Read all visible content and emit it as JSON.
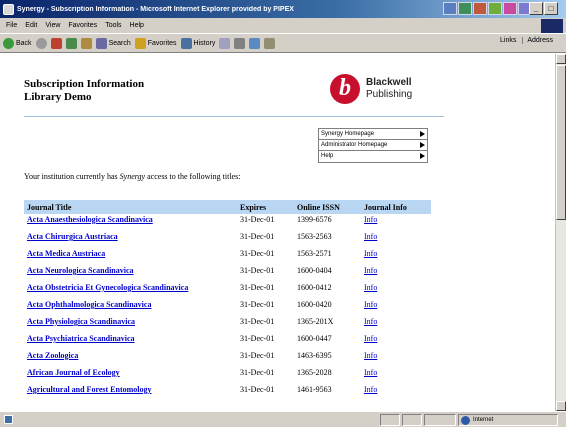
{
  "window": {
    "title": "Synergy - Subscription Information - Microsoft Internet Explorer provided by PIPEX",
    "min_glyph": "_",
    "max_glyph": "□",
    "close_glyph": "×"
  },
  "menubar": {
    "items": [
      "File",
      "Edit",
      "View",
      "Favorites",
      "Tools",
      "Help"
    ]
  },
  "toolbar": {
    "back_label": "Back",
    "search_label": "Search",
    "favorites_label": "Favorites",
    "history_label": "History",
    "links_label": "Links",
    "address_label": "Address"
  },
  "page": {
    "title_line1": "Subscription Information",
    "title_line2": "Library Demo",
    "logo": {
      "mark": "b",
      "line1": "Blackwell",
      "line2": "Publishing",
      "color": "#c8102e"
    },
    "nav": [
      "Synergy Homepage",
      "Administrator Homepage",
      "Help"
    ],
    "intro_before": "Your institution currently has ",
    "intro_em": "Synergy",
    "intro_after": " access to the following titles:",
    "table": {
      "headers": [
        "Journal Title",
        "Expires",
        "Online ISSN",
        "Journal Info"
      ],
      "rows": [
        {
          "title": "Acta Anaesthesiologica Scandinavica",
          "expires": "31-Dec-01",
          "issn": "1399-6576",
          "info": "Info"
        },
        {
          "title": "Acta Chirurgica Austriaca",
          "expires": "31-Dec-01",
          "issn": "1563-2563",
          "info": "Info"
        },
        {
          "title": "Acta Medica Austriaca",
          "expires": "31-Dec-01",
          "issn": "1563-2571",
          "info": "Info"
        },
        {
          "title": "Acta Neurologica Scandinavica",
          "expires": "31-Dec-01",
          "issn": "1600-0404",
          "info": "Info"
        },
        {
          "title": "Acta Obstetricia Et Gynecologica Scandinavica",
          "expires": "31-Dec-01",
          "issn": "1600-0412",
          "info": "Info"
        },
        {
          "title": "Acta Ophthalmologica Scandinavica",
          "expires": "31-Dec-01",
          "issn": "1600-0420",
          "info": "Info"
        },
        {
          "title": "Acta Physiologica Scandinavica",
          "expires": "31-Dec-01",
          "issn": "1365-201X",
          "info": "Info"
        },
        {
          "title": "Acta Psychiatrica Scandinavica",
          "expires": "31-Dec-01",
          "issn": "1600-0447",
          "info": "Info"
        },
        {
          "title": "Acta Zoologica",
          "expires": "31-Dec-01",
          "issn": "1463-6395",
          "info": "Info"
        },
        {
          "title": "African Journal of Ecology",
          "expires": "31-Dec-01",
          "issn": "1365-2028",
          "info": "Info"
        },
        {
          "title": "Agricultural and Forest Entomology",
          "expires": "31-Dec-01",
          "issn": "1461-9563",
          "info": "Info"
        }
      ]
    }
  },
  "status": {
    "zone": "Internet"
  },
  "colors": {
    "header_bg": "#b9d6f2",
    "link": "#0000cc",
    "rule": "#9ec0de"
  }
}
